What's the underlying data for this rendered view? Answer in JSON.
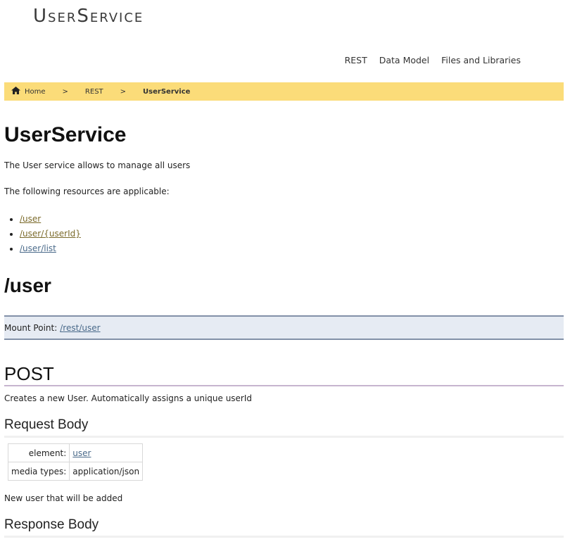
{
  "logo": "UserService",
  "nav": {
    "items": [
      "REST",
      "Data Model",
      "Files and Libraries"
    ]
  },
  "breadcrumb": {
    "home": "Home",
    "sep1": ">",
    "rest": "REST",
    "sep2": ">",
    "current": "UserService"
  },
  "page": {
    "title": "UserService",
    "description": "The User service allows to manage all users",
    "applicable": "The following resources are applicable:",
    "resources": [
      "/user",
      "/user/{userId}",
      "/user/list"
    ]
  },
  "resource": {
    "title": "/user",
    "mount_label": "Mount Point:",
    "mount_link": "/rest/user"
  },
  "method": {
    "name": "POST",
    "description": "Creates a new User. Automatically assigns a unique userId",
    "request_body_title": "Request Body",
    "element_label": "element:",
    "element_value": "user",
    "media_label": "media types:",
    "media_value": "application/json",
    "request_note": "New user that will be added",
    "response_body_title": "Response Body"
  },
  "colors": {
    "breadcrumb_bg": "#fbdc79",
    "mount_bg": "#e6ebf3",
    "link_gold": "#7b6a2a",
    "link_blue": "#4a6a8a"
  }
}
